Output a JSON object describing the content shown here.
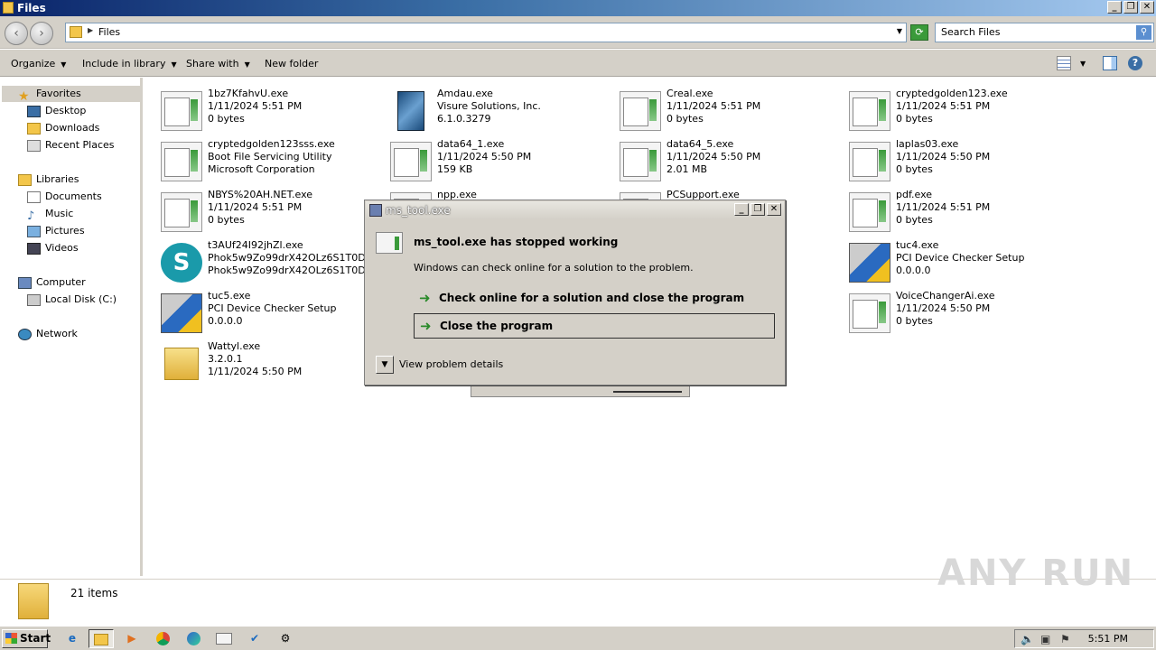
{
  "window": {
    "title": "Files",
    "icon": "folder-icon",
    "minimize": "_",
    "restore": "❐",
    "close": "✕"
  },
  "address": {
    "path": "Files",
    "search_placeholder": "Search Files"
  },
  "toolbar": {
    "organize": "Organize",
    "include_in_library": "Include in library",
    "share_with": "Share with",
    "new_folder": "New folder"
  },
  "sidebar": {
    "favorites": "Favorites",
    "desktop": "Desktop",
    "downloads": "Downloads",
    "recent_places": "Recent Places",
    "libraries": "Libraries",
    "documents": "Documents",
    "music": "Music",
    "pictures": "Pictures",
    "videos": "Videos",
    "computer": "Computer",
    "local_disk": "Local Disk (C:)",
    "network": "Network"
  },
  "files": [
    {
      "name": "1bz7KfahvU.exe",
      "line2": "1/11/2024 5:51 PM",
      "line3": "0 bytes",
      "icon": "exe"
    },
    {
      "name": "Amdau.exe",
      "line2": "Visure Solutions, Inc.",
      "line3": "6.1.0.3279",
      "icon": "box"
    },
    {
      "name": "Creal.exe",
      "line2": "1/11/2024 5:51 PM",
      "line3": "0 bytes",
      "icon": "exe"
    },
    {
      "name": "cryptedgolden123.exe",
      "line2": "1/11/2024 5:51 PM",
      "line3": "0 bytes",
      "icon": "exe"
    },
    {
      "name": "cryptedgolden123sss.exe",
      "line2": "Boot File Servicing Utility",
      "line3": "Microsoft Corporation",
      "icon": "exe"
    },
    {
      "name": "data64_1.exe",
      "line2": "1/11/2024 5:50 PM",
      "line3": "159 KB",
      "icon": "exe"
    },
    {
      "name": "data64_5.exe",
      "line2": "1/11/2024 5:50 PM",
      "line3": "2.01 MB",
      "icon": "exe"
    },
    {
      "name": "laplas03.exe",
      "line2": "1/11/2024 5:50 PM",
      "line3": "0 bytes",
      "icon": "exe"
    },
    {
      "name": "NBYS%20AH.NET.exe",
      "line2": "1/11/2024 5:51 PM",
      "line3": "0 bytes",
      "icon": "exe"
    },
    {
      "name": "npp.exe",
      "line2": "",
      "line3": "",
      "icon": "exe"
    },
    {
      "name": "PCSupport.exe",
      "line2": "",
      "line3": "",
      "icon": "exe"
    },
    {
      "name": "pdf.exe",
      "line2": "1/11/2024 5:51 PM",
      "line3": "0 bytes",
      "icon": "exe"
    },
    {
      "name": "t3AUf24I92jhZl.exe",
      "line2": "Phok5w9Zo99drX42OLz6S1T0D",
      "line3": "Phok5w9Zo99drX42OLz6S1T0D Soft",
      "icon": "surfshark"
    },
    {
      "name": "tuc4.exe",
      "line2": "PCI Device Checker Setup",
      "line3": "0.0.0.0",
      "icon": "setup"
    },
    {
      "name": "tuc5.exe",
      "line2": "PCI Device Checker Setup",
      "line3": "0.0.0.0",
      "icon": "setup"
    },
    {
      "name": "VoiceChangerAi.exe",
      "line2": "1/11/2024 5:50 PM",
      "line3": "0 bytes",
      "icon": "exe"
    },
    {
      "name": "Wattyl.exe",
      "line2": "3.2.0.1",
      "line3": "1/11/2024 5:50 PM",
      "icon": "folder"
    }
  ],
  "status": {
    "item_count": "21 items"
  },
  "dialog": {
    "title": "ms_tool.exe",
    "header": "ms_tool.exe has stopped working",
    "subtext": "Windows can check online for a solution to the problem.",
    "option_check": "Check online for a solution and close the program",
    "option_close": "Close the program",
    "details": "View problem details"
  },
  "taskbar": {
    "start": "Start",
    "clock": "5:51 PM"
  },
  "watermark": "ANY RUN"
}
